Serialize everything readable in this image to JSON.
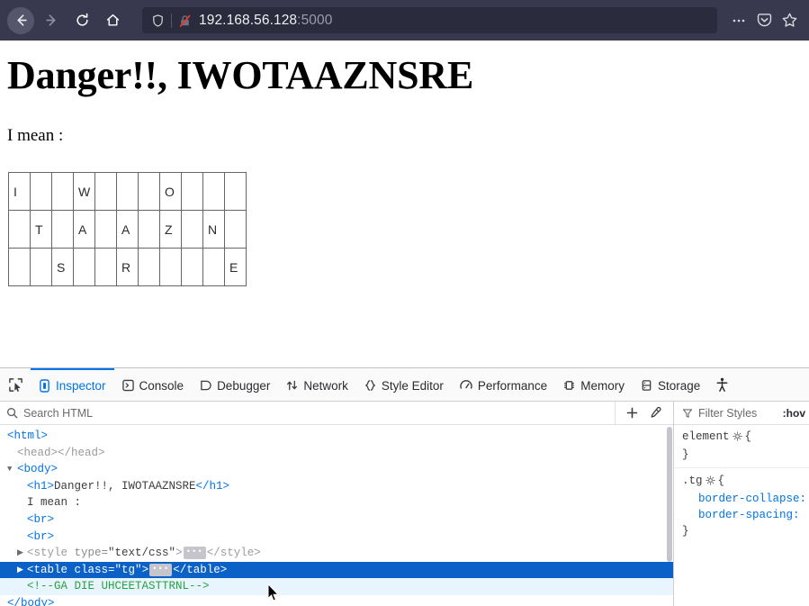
{
  "browser": {
    "nav": {
      "back_label": "Back",
      "forward_label": "Forward",
      "reload_label": "Reload",
      "home_label": "Home"
    },
    "url": {
      "host": "192.168.56.128",
      "port": ":5000",
      "shield_title": "Enhanced Tracking Protection",
      "lock_title": "Connection is not secure"
    },
    "actions": {
      "menu_label": "Open application menu",
      "pocket_label": "Save to Pocket",
      "bookmark_label": "Bookmark this page"
    }
  },
  "page": {
    "heading": "Danger!!, IWOTAAZNSRE",
    "intro": "I mean :",
    "table": {
      "rows": 3,
      "cols": 11,
      "cells": [
        [
          "I",
          "",
          "",
          "W",
          "",
          "",
          "",
          "O",
          "",
          "",
          ""
        ],
        [
          "",
          "T",
          "",
          "A",
          "",
          "A",
          "",
          "Z",
          "",
          "N",
          ""
        ],
        [
          "",
          "",
          "S",
          "",
          "",
          "R",
          "",
          "",
          "",
          "",
          "E"
        ]
      ]
    }
  },
  "devtools": {
    "picker_label": "Pick an element from the page",
    "tabs": [
      {
        "label": "Inspector",
        "icon": "inspector-icon",
        "active": true
      },
      {
        "label": "Console",
        "icon": "console-icon",
        "active": false
      },
      {
        "label": "Debugger",
        "icon": "debugger-icon",
        "active": false
      },
      {
        "label": "Network",
        "icon": "network-icon",
        "active": false
      },
      {
        "label": "Style Editor",
        "icon": "style-editor-icon",
        "active": false
      },
      {
        "label": "Performance",
        "icon": "performance-icon",
        "active": false
      },
      {
        "label": "Memory",
        "icon": "memory-icon",
        "active": false
      },
      {
        "label": "Storage",
        "icon": "storage-icon",
        "active": false
      }
    ],
    "accessibility_label": "Accessibility",
    "search": {
      "placeholder": "Search HTML",
      "add_node_label": "Create new node",
      "eyedropper_label": "Grab a color from the page"
    },
    "markup": {
      "l1": "<html>",
      "l2": "<head></head>",
      "l3": "<body>",
      "l4_open": "<h1>",
      "l4_text": "Danger!!, IWOTAAZNSRE",
      "l4_close": "</h1>",
      "l5": "I mean :",
      "l6": "<br>",
      "l7": "<br>",
      "l8_tag": "<style",
      "l8_attr": "type=",
      "l8_val": "\"text/css\"",
      "l8_gt": ">",
      "l8_close": "</style>",
      "l9_tag": "<table",
      "l9_attr": "class=",
      "l9_val": "\"tg\"",
      "l9_gt": ">",
      "l9_close": "</table>",
      "l10_comment": "<!--GA DIE UHCEETASTTRNL-->",
      "l11": "</body>"
    },
    "styles": {
      "filter_placeholder": "Filter Styles",
      "hov_label": ":hov",
      "rules": [
        {
          "selector": "element",
          "declarations": []
        },
        {
          "selector": ".tg",
          "declarations": [
            "border-collapse:",
            "border-spacing:"
          ]
        }
      ]
    }
  },
  "colors": {
    "chrome_bg": "#38394f",
    "urlbar_bg": "#2a2b3c",
    "accent": "#0074e8",
    "selection": "#0b61c6",
    "highlight": "#e8f5fe",
    "comment_green": "#23a33b",
    "cell_text": "#2b2b2b"
  }
}
